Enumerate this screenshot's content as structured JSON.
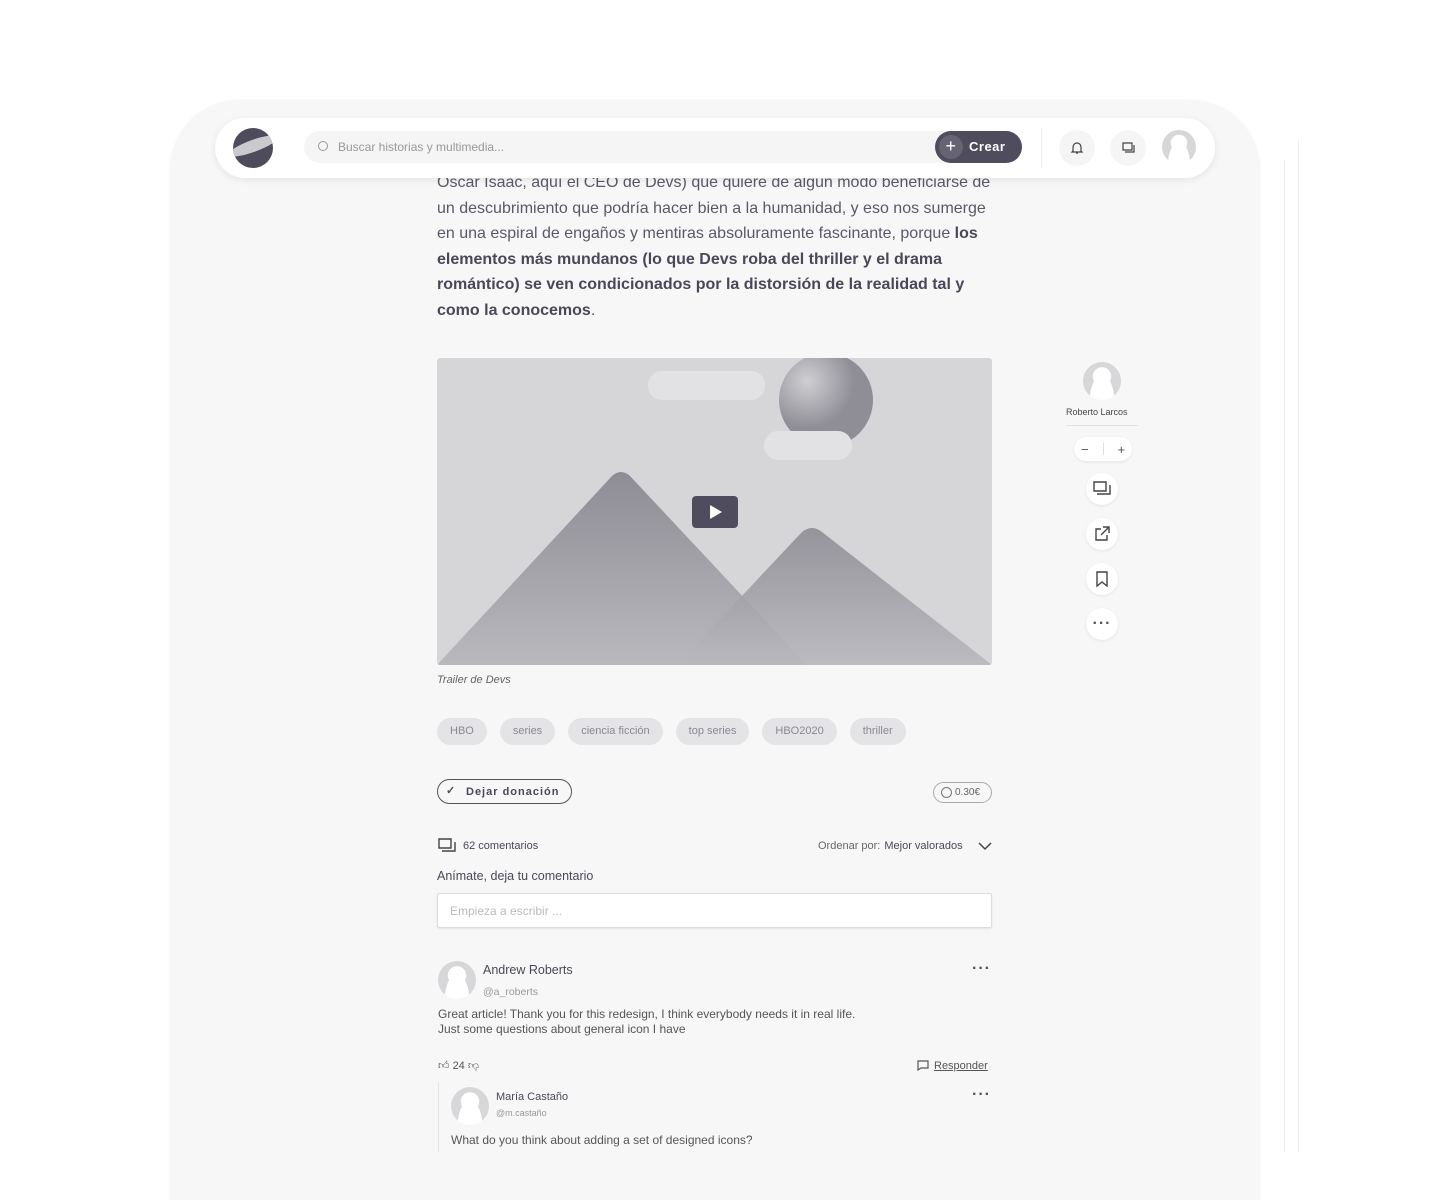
{
  "header": {
    "search_placeholder": "Buscar historias y multimedia...",
    "create_label": "Crear"
  },
  "article": {
    "p1": "Oscar Isaac, aquí el CEO de Devs) que quiere de algún modo beneficiarse de un descubrimiento que podría hacer bien a la humanidad, y eso nos sumerge en una espiral de engaños y mentiras absoluramente fascinante, porque ",
    "p1_bold": "los elementos más mundanos (lo que Devs roba del thriller y el drama romántico) se ven condicionados por la distorsión de la realidad tal y como la conocemos",
    "p1_end": ".",
    "media_caption": "Trailer de Devs",
    "tags": [
      "HBO",
      "series",
      "ciencia ficción",
      "top series",
      "HBO2020",
      "thriller"
    ],
    "donate_label": "Dejar donación",
    "price": "0.30€"
  },
  "sidebar": {
    "author": "Roberto Larcos",
    "minus": "−",
    "plus": "+"
  },
  "comments": {
    "count_label": "62 comentarios",
    "sort_label": "Ordenar por:",
    "sort_value": "Mejor valorados",
    "prompt": "Anímate, deja tu comentario",
    "input_placeholder": "Empieza a escribir ...",
    "items": [
      {
        "name": "Andrew Roberts",
        "handle": "@a_roberts",
        "text1": "Great article! Thank you for this redesign, I think everybody needs it in real life.",
        "text2": "Just some questions about general icon I have",
        "likes": "24",
        "reply": "Responder"
      },
      {
        "name": "María Castaño",
        "handle": "@m.castaño",
        "text1": "What do you think about adding a set of designed icons?"
      }
    ]
  },
  "colors": {
    "accent": "#4f4c5d",
    "background": "#f7f7f7"
  }
}
